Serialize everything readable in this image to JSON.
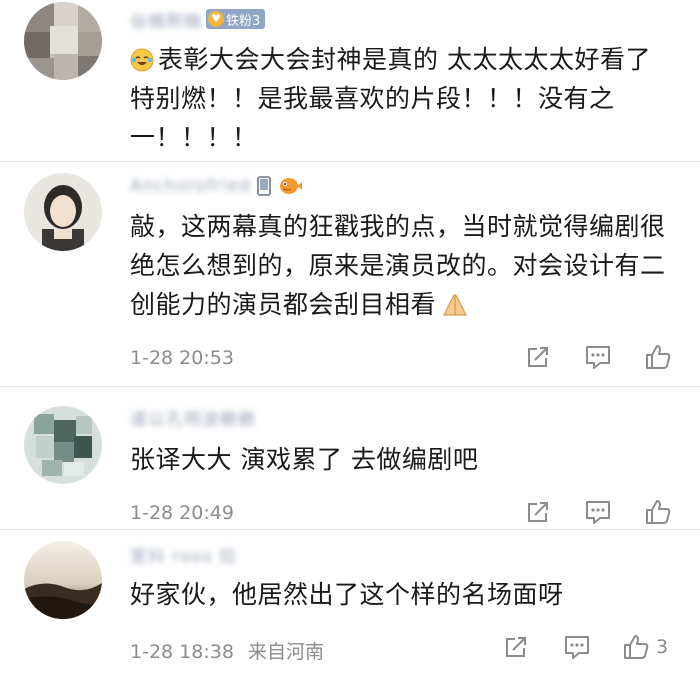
{
  "comments": [
    {
      "username": "谷楠荆楠",
      "badge": {
        "label": "铁粉3",
        "icon": "heart-badge-icon"
      },
      "emoji_prefix": "laughing-crying-emoji-icon",
      "text": "表彰大会大会封神是真的 太太太太太好看了 特别燃！！是我最喜欢的片段！！！没有之一！！！！"
    },
    {
      "username": "Anchorofried",
      "badges": [
        "phone-icon",
        "pufferfish-icon"
      ],
      "text": "敲，这两幕真的狂戳我的点，当时就觉得编剧很绝怎么想到的，原来是演员改的。对会设计有二创能力的演员都会刮目相看",
      "emoji_suffix": "folded-hands-icon",
      "time": "1-28 20:53"
    },
    {
      "username": "道以孔明波赖赖",
      "text": "张译大大 演戏累了 去做编剧吧",
      "time": "1-28 20:49"
    },
    {
      "username": "室抖 roos 拉",
      "text": "好家伙，他居然出了这个样的名场面呀",
      "time": "1-28 18:38",
      "location": "来自河南",
      "like_count": "3"
    }
  ]
}
